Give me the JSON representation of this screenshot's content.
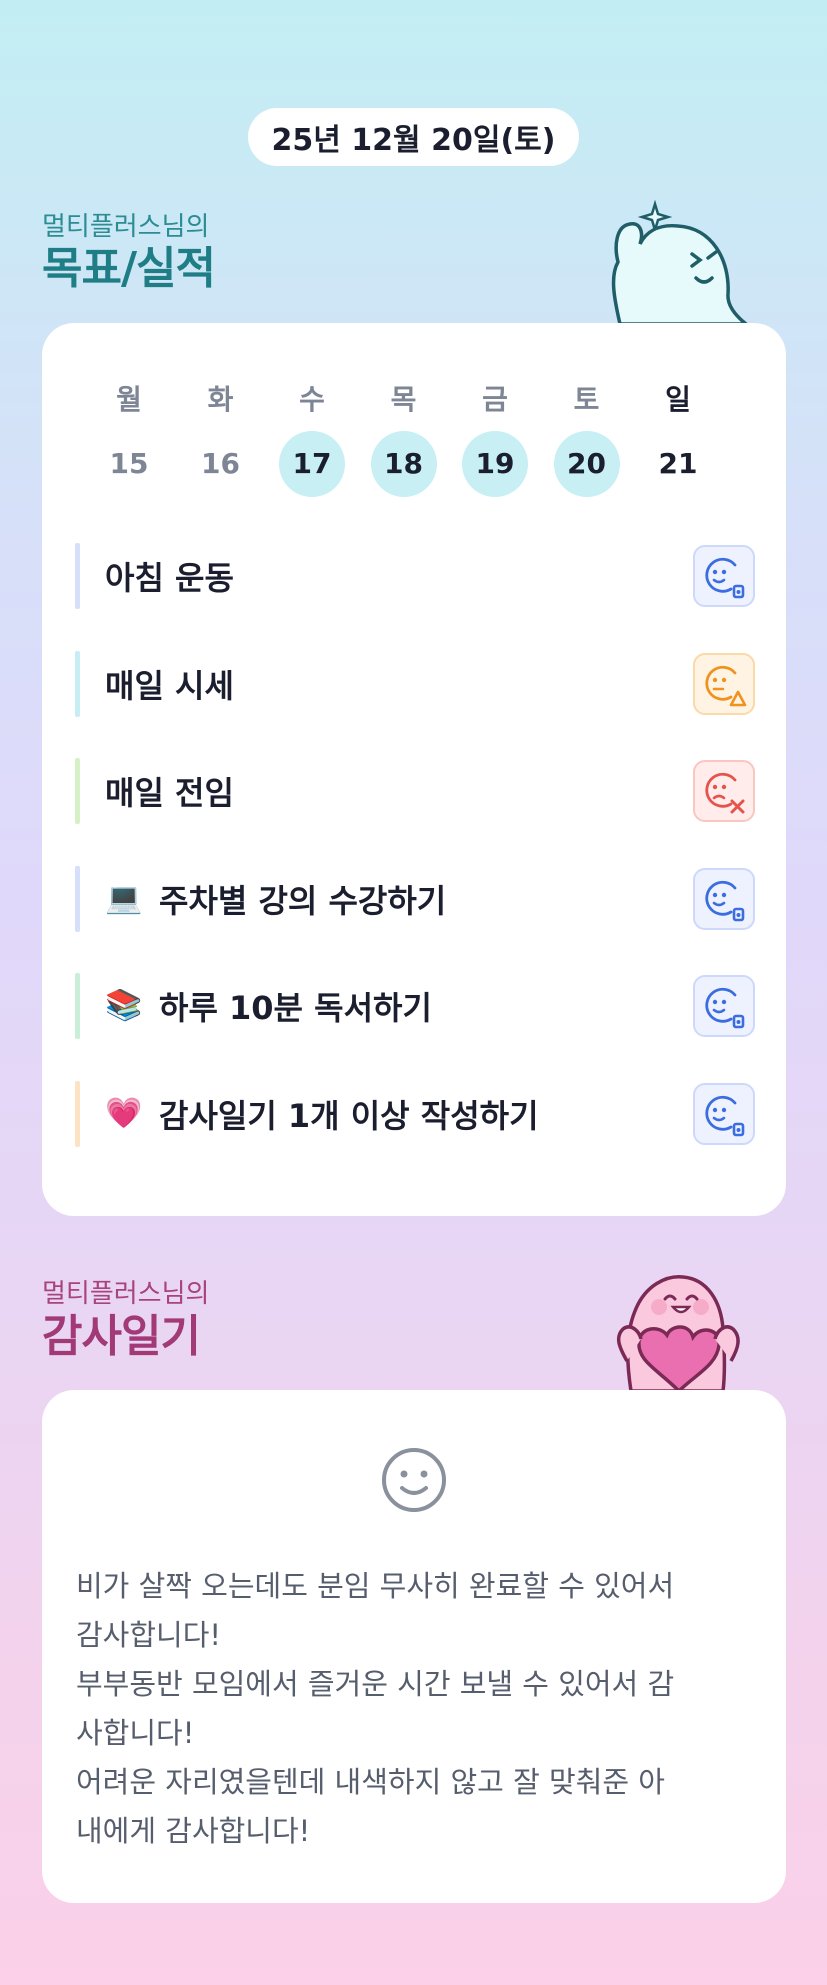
{
  "header": {
    "date": "25년 12월 20일(토)"
  },
  "goals_section": {
    "subtitle": "멀티플러스님의",
    "title": "목표/실적"
  },
  "calendar": {
    "weekdays": [
      "월",
      "화",
      "수",
      "목",
      "금",
      "토",
      "일"
    ],
    "days": [
      {
        "num": "15",
        "done": false
      },
      {
        "num": "16",
        "done": false
      },
      {
        "num": "17",
        "done": true
      },
      {
        "num": "18",
        "done": true
      },
      {
        "num": "19",
        "done": true
      },
      {
        "num": "20",
        "done": true
      },
      {
        "num": "21",
        "done": false
      }
    ]
  },
  "goals": [
    {
      "label": "아침 운동",
      "emoji": "",
      "bar_color": "#d6e0fb",
      "status": "success"
    },
    {
      "label": "매일 시세",
      "emoji": "",
      "bar_color": "#c7eef3",
      "status": "warning"
    },
    {
      "label": "매일 전임",
      "emoji": "",
      "bar_color": "#d7f1c6",
      "status": "fail"
    },
    {
      "label": "주차별 강의 수강하기",
      "emoji": "💻",
      "bar_color": "#d6e0fb",
      "status": "success"
    },
    {
      "label": "하루 10분 독서하기",
      "emoji": "📚",
      "bar_color": "#c9efd9",
      "status": "success"
    },
    {
      "label": "감사일기 1개 이상 작성하기",
      "emoji": "💗",
      "bar_color": "#fde2c4",
      "status": "success"
    }
  ],
  "gratitude_section": {
    "subtitle": "멀티플러스님의",
    "title": "감사일기"
  },
  "diary": {
    "lines": [
      "비가 살짝 오는데도 분임 무사히 완료할 수 있어서",
      "감사합니다!",
      "부부동반 모임에서 즐거운 시간 보낼 수 있어서 감",
      "사합니다!",
      "어려운 자리였을텐데 내색하지 않고 잘 맞춰준 아",
      "내에게 감사합니다!"
    ]
  },
  "colors": {
    "success": "#3b6de0",
    "warning": "#f0921e",
    "fail": "#e5534b",
    "accent_teal": "#1f7d86",
    "accent_magenta": "#a23a78"
  }
}
